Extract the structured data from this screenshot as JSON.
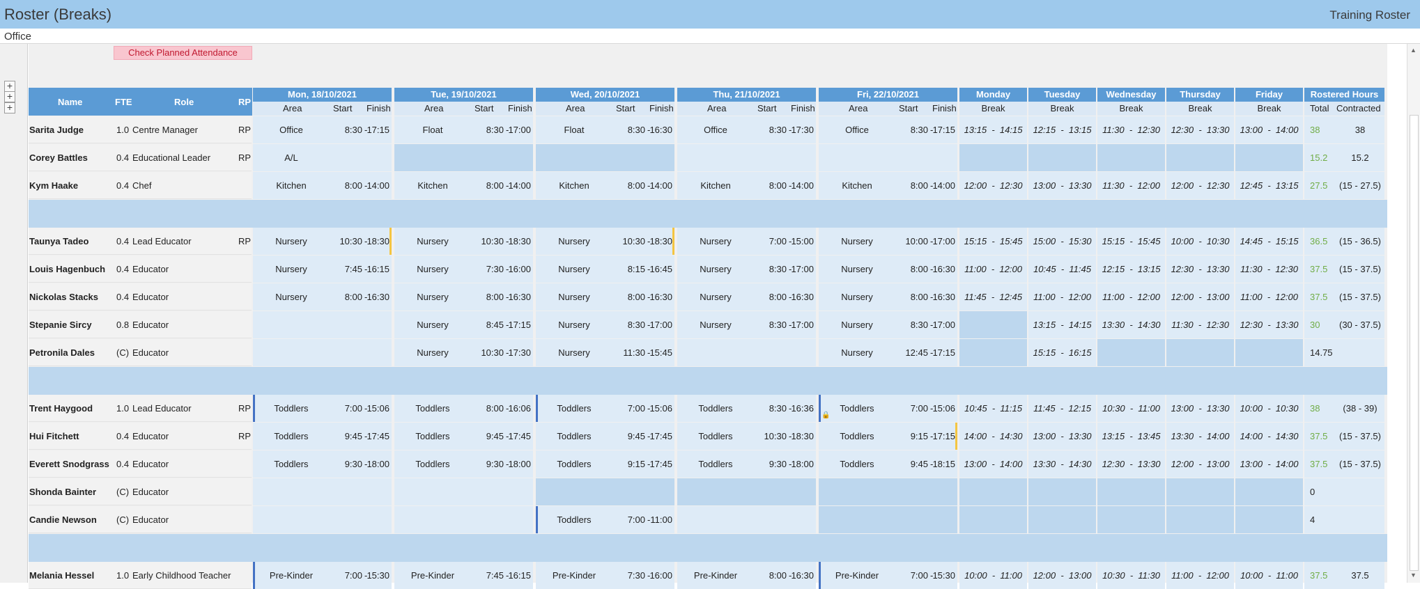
{
  "app": {
    "title": "Roster (Breaks)",
    "right_title": "Training Roster",
    "location": "Office",
    "check_button": "Check Planned Attendance"
  },
  "expanders": [
    "+",
    "+",
    "+"
  ],
  "headers": {
    "name": "Name",
    "fte": "FTE",
    "role": "Role",
    "rp": "RP",
    "days": [
      "Mon, 18/10/2021",
      "Tue, 19/10/2021",
      "Wed, 20/10/2021",
      "Thu, 21/10/2021",
      "Fri, 22/10/2021"
    ],
    "sub_area": "Area",
    "sub_start": "Start",
    "sub_finish": "Finish",
    "break_days": [
      "Monday",
      "Tuesday",
      "Wednesday",
      "Thursday",
      "Friday"
    ],
    "sub_break": "Break",
    "rostered": "Rostered Hours",
    "sub_total": "Total",
    "sub_contracted": "Contracted"
  },
  "colors": {
    "header": "#5b9bd5",
    "cell": "#deebf7",
    "empty": "#bdd7ee",
    "marker_yellow": "#f4c542",
    "marker_blue": "#4472c4",
    "total_green": "#70ad47"
  },
  "groups": [
    [
      {
        "name": "Sarita Judge",
        "fte": "1.0",
        "role": "Centre Manager",
        "rp": "RP",
        "days": [
          {
            "area": "Office",
            "start": "8:30",
            "finish": "17:15"
          },
          {
            "area": "Float",
            "start": "8:30",
            "finish": "17:00"
          },
          {
            "area": "Float",
            "start": "8:30",
            "finish": "16:30"
          },
          {
            "area": "Office",
            "start": "8:30",
            "finish": "17:30"
          },
          {
            "area": "Office",
            "start": "8:30",
            "finish": "17:15"
          }
        ],
        "breaks": [
          "13:15  -  14:15",
          "12:15  -  13:15",
          "11:30  -  12:30",
          "12:30  -  13:30",
          "13:00  -  14:00"
        ],
        "total": "38",
        "contracted": "38"
      },
      {
        "name": "Corey Battles",
        "fte": "0.4",
        "role": "Educational Leader",
        "rp": "RP",
        "days": [
          {
            "area": "A/L",
            "start": "",
            "finish": ""
          },
          null,
          null,
          {
            "area": "",
            "start": "",
            "finish": ""
          },
          {
            "area": "",
            "start": "",
            "finish": ""
          }
        ],
        "breaks": [
          null,
          null,
          null,
          null,
          null
        ],
        "total": "15.2",
        "contracted": "15.2"
      },
      {
        "name": "Kym Haake",
        "fte": "0.4",
        "role": "Chef",
        "rp": "",
        "days": [
          {
            "area": "Kitchen",
            "start": "8:00",
            "finish": "14:00"
          },
          {
            "area": "Kitchen",
            "start": "8:00",
            "finish": "14:00"
          },
          {
            "area": "Kitchen",
            "start": "8:00",
            "finish": "14:00"
          },
          {
            "area": "Kitchen",
            "start": "8:00",
            "finish": "14:00"
          },
          {
            "area": "Kitchen",
            "start": "8:00",
            "finish": "14:00"
          }
        ],
        "breaks": [
          "12:00  -  12:30",
          "13:00  -  13:30",
          "11:30  -  12:00",
          "12:00  -  12:30",
          "12:45  -  13:15"
        ],
        "total": "27.5",
        "contracted": "(15 - 27.5)"
      }
    ],
    [
      {
        "name": "Taunya Tadeo",
        "fte": "0.4",
        "role": "Lead Educator",
        "rp": "RP",
        "days": [
          {
            "area": "Nursery",
            "start": "10:30",
            "finish": "18:30",
            "marker": "yellow"
          },
          {
            "area": "Nursery",
            "start": "10:30",
            "finish": "18:30"
          },
          {
            "area": "Nursery",
            "start": "10:30",
            "finish": "18:30",
            "marker": "yellow"
          },
          {
            "area": "Nursery",
            "start": "7:00",
            "finish": "15:00"
          },
          {
            "area": "Nursery",
            "start": "10:00",
            "finish": "17:00"
          }
        ],
        "breaks": [
          "15:15  -  15:45",
          "15:00  -  15:30",
          "15:15  -  15:45",
          "10:00  -  10:30",
          "14:45  -  15:15"
        ],
        "total": "36.5",
        "contracted": "(15 - 36.5)"
      },
      {
        "name": "Louis Hagenbuch",
        "fte": "0.4",
        "role": "Educator",
        "rp": "",
        "days": [
          {
            "area": "Nursery",
            "start": "7:45",
            "finish": "16:15"
          },
          {
            "area": "Nursery",
            "start": "7:30",
            "finish": "16:00"
          },
          {
            "area": "Nursery",
            "start": "8:15",
            "finish": "16:45"
          },
          {
            "area": "Nursery",
            "start": "8:30",
            "finish": "17:00"
          },
          {
            "area": "Nursery",
            "start": "8:00",
            "finish": "16:30"
          }
        ],
        "breaks": [
          "11:00  -  12:00",
          "10:45  -  11:45",
          "12:15  -  13:15",
          "12:30  -  13:30",
          "11:30  -  12:30"
        ],
        "total": "37.5",
        "contracted": "(15 - 37.5)"
      },
      {
        "name": "Nickolas Stacks",
        "fte": "0.4",
        "role": "Educator",
        "rp": "",
        "days": [
          {
            "area": "Nursery",
            "start": "8:00",
            "finish": "16:30"
          },
          {
            "area": "Nursery",
            "start": "8:00",
            "finish": "16:30"
          },
          {
            "area": "Nursery",
            "start": "8:00",
            "finish": "16:30"
          },
          {
            "area": "Nursery",
            "start": "8:00",
            "finish": "16:30"
          },
          {
            "area": "Nursery",
            "start": "8:00",
            "finish": "16:30"
          }
        ],
        "breaks": [
          "11:45  -  12:45",
          "11:00  -  12:00",
          "11:00  -  12:00",
          "12:00  -  13:00",
          "11:00  -  12:00"
        ],
        "total": "37.5",
        "contracted": "(15 - 37.5)"
      },
      {
        "name": "Stepanie Sircy",
        "fte": "0.8",
        "role": "Educator",
        "rp": "",
        "days": [
          {
            "area": "",
            "start": "",
            "finish": ""
          },
          {
            "area": "Nursery",
            "start": "8:45",
            "finish": "17:15"
          },
          {
            "area": "Nursery",
            "start": "8:30",
            "finish": "17:00"
          },
          {
            "area": "Nursery",
            "start": "8:30",
            "finish": "17:00"
          },
          {
            "area": "Nursery",
            "start": "8:30",
            "finish": "17:00"
          }
        ],
        "breaks": [
          null,
          "13:15  -  14:15",
          "13:30  -  14:30",
          "11:30  -  12:30",
          "12:30  -  13:30"
        ],
        "total": "30",
        "contracted": "(30 - 37.5)"
      },
      {
        "name": "Petronila Dales",
        "fte": "(C)",
        "role": "Educator",
        "rp": "",
        "days": [
          {
            "area": "",
            "start": "",
            "finish": ""
          },
          {
            "area": "Nursery",
            "start": "10:30",
            "finish": "17:30"
          },
          {
            "area": "Nursery",
            "start": "11:30",
            "finish": "15:45"
          },
          {
            "area": "",
            "start": "",
            "finish": ""
          },
          {
            "area": "Nursery",
            "start": "12:45",
            "finish": "17:15"
          }
        ],
        "breaks": [
          null,
          "15:15  -  16:15",
          null,
          null,
          null
        ],
        "total": "14.75",
        "contracted": "",
        "total_plain": true
      }
    ],
    [
      {
        "name": "Trent Haygood",
        "fte": "1.0",
        "role": "Lead Educator",
        "rp": "RP",
        "days": [
          {
            "area": "Toddlers",
            "start": "7:00",
            "finish": "15:06",
            "marker": "blue"
          },
          {
            "area": "Toddlers",
            "start": "8:00",
            "finish": "16:06"
          },
          {
            "area": "Toddlers",
            "start": "7:00",
            "finish": "15:06",
            "marker": "blue"
          },
          {
            "area": "Toddlers",
            "start": "8:30",
            "finish": "16:36"
          },
          {
            "area": "Toddlers",
            "start": "7:00",
            "finish": "15:06",
            "marker": "blue",
            "lock": true
          }
        ],
        "breaks": [
          "10:45  -  11:15",
          "11:45  -  12:15",
          "10:30  -  11:00",
          "13:00  -  13:30",
          "10:00  -  10:30"
        ],
        "total": "38",
        "contracted": "(38 - 39)"
      },
      {
        "name": "Hui Fitchett",
        "fte": "0.4",
        "role": "Educator",
        "rp": "RP",
        "days": [
          {
            "area": "Toddlers",
            "start": "9:45",
            "finish": "17:45"
          },
          {
            "area": "Toddlers",
            "start": "9:45",
            "finish": "17:45"
          },
          {
            "area": "Toddlers",
            "start": "9:45",
            "finish": "17:45"
          },
          {
            "area": "Toddlers",
            "start": "10:30",
            "finish": "18:30"
          },
          {
            "area": "Toddlers",
            "start": "9:15",
            "finish": "17:15",
            "marker": "yellow"
          }
        ],
        "breaks": [
          "14:00  -  14:30",
          "13:00  -  13:30",
          "13:15  -  13:45",
          "13:30  -  14:00",
          "14:00  -  14:30"
        ],
        "total": "37.5",
        "contracted": "(15 - 37.5)"
      },
      {
        "name": "Everett Snodgrass",
        "fte": "0.4",
        "role": "Educator",
        "rp": "",
        "days": [
          {
            "area": "Toddlers",
            "start": "9:30",
            "finish": "18:00"
          },
          {
            "area": "Toddlers",
            "start": "9:30",
            "finish": "18:00"
          },
          {
            "area": "Toddlers",
            "start": "9:15",
            "finish": "17:45"
          },
          {
            "area": "Toddlers",
            "start": "9:30",
            "finish": "18:00"
          },
          {
            "area": "Toddlers",
            "start": "9:45",
            "finish": "18:15"
          }
        ],
        "breaks": [
          "13:00  -  14:00",
          "13:30  -  14:30",
          "12:30  -  13:30",
          "12:00  -  13:00",
          "13:00  -  14:00"
        ],
        "total": "37.5",
        "contracted": "(15 - 37.5)"
      },
      {
        "name": "Shonda Bainter",
        "fte": "(C)",
        "role": "Educator",
        "rp": "",
        "days": [
          {
            "area": "",
            "start": "",
            "finish": ""
          },
          {
            "area": "",
            "start": "",
            "finish": ""
          },
          null,
          null,
          null
        ],
        "breaks": [
          null,
          null,
          null,
          null,
          null
        ],
        "total": "0",
        "contracted": "",
        "total_plain": true
      },
      {
        "name": "Candie Newson",
        "fte": "(C)",
        "role": "Educator",
        "rp": "",
        "days": [
          {
            "area": "",
            "start": "",
            "finish": ""
          },
          {
            "area": "",
            "start": "",
            "finish": ""
          },
          {
            "area": "Toddlers",
            "start": "7:00",
            "finish": "11:00",
            "marker": "blue"
          },
          {
            "area": "",
            "start": "",
            "finish": ""
          },
          null
        ],
        "breaks": [
          null,
          null,
          null,
          null,
          null
        ],
        "total": "4",
        "contracted": "",
        "total_plain": true
      }
    ],
    [
      {
        "name": "Melania Hessel",
        "fte": "1.0",
        "role": "Early Childhood Teacher",
        "rp": "",
        "days": [
          {
            "area": "Pre-Kinder",
            "start": "7:00",
            "finish": "15:30",
            "marker": "blue"
          },
          {
            "area": "Pre-Kinder",
            "start": "7:45",
            "finish": "16:15"
          },
          {
            "area": "Pre-Kinder",
            "start": "7:30",
            "finish": "16:00"
          },
          {
            "area": "Pre-Kinder",
            "start": "8:00",
            "finish": "16:30"
          },
          {
            "area": "Pre-Kinder",
            "start": "7:00",
            "finish": "15:30",
            "marker": "blue"
          }
        ],
        "breaks": [
          "10:00  -  11:00",
          "12:00  -  13:00",
          "10:30  -  11:30",
          "11:00  -  12:00",
          "10:00  -  11:00"
        ],
        "total": "37.5",
        "contracted": "37.5"
      }
    ]
  ]
}
